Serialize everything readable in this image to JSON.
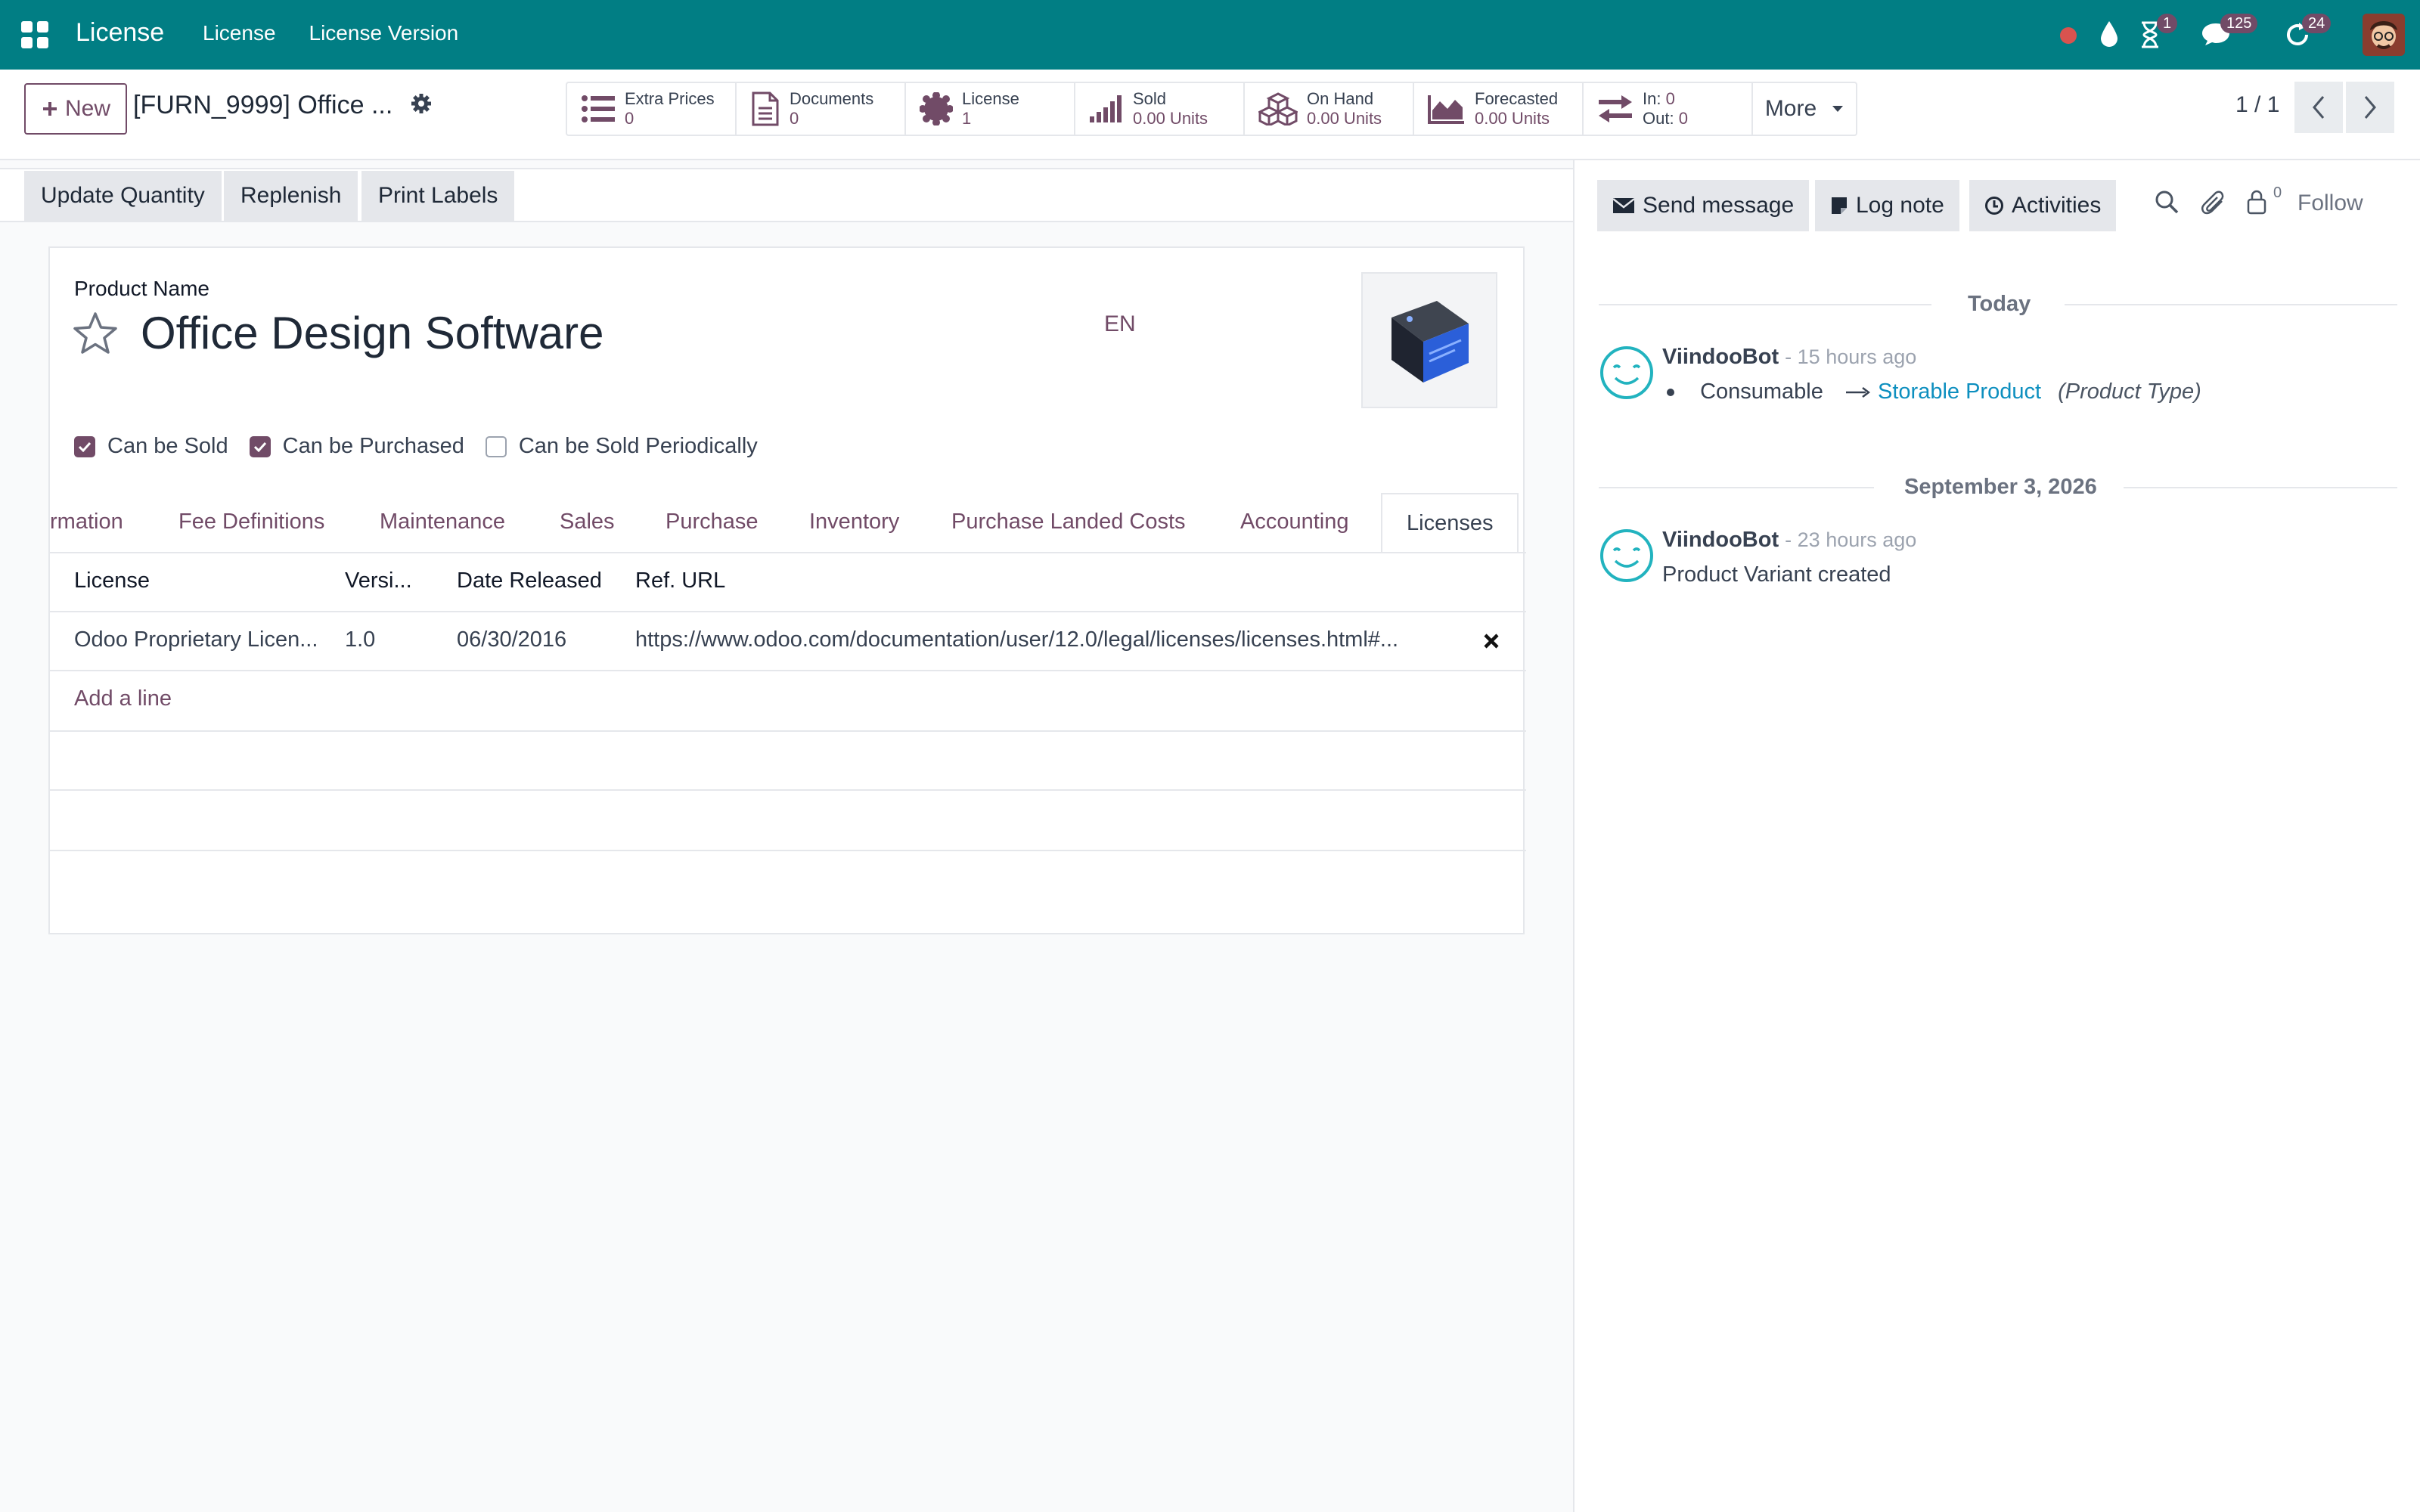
{
  "topbar": {
    "app_title": "License",
    "menu": [
      "License",
      "License Version"
    ],
    "badges": {
      "activity": "1",
      "messages": "125",
      "updates": "24"
    }
  },
  "control": {
    "new_label": "New",
    "breadcrumb": "[FURN_9999] Office ...",
    "smart_buttons": [
      {
        "label": "Extra Prices",
        "value": "0",
        "icon": "list-icon"
      },
      {
        "label": "Documents",
        "value": "0",
        "icon": "document-icon"
      },
      {
        "label": "License",
        "value": "1",
        "icon": "certificate-icon"
      },
      {
        "label": "Sold",
        "value": "0.00 Units",
        "icon": "signal-icon"
      },
      {
        "label": "On Hand",
        "value": "0.00 Units",
        "icon": "cubes-icon"
      },
      {
        "label": "Forecasted",
        "value": "0.00 Units",
        "icon": "area-chart-icon"
      },
      {
        "in": "In:",
        "in_val": "0",
        "out": "Out:",
        "out_val": "0",
        "icon": "exchange-icon"
      }
    ],
    "more_label": "More",
    "pager": "1 / 1"
  },
  "actions": [
    "Update Quantity",
    "Replenish",
    "Print Labels"
  ],
  "form": {
    "name_label": "Product Name",
    "product_name": "Office Design Software",
    "lang": "EN",
    "checkboxes": [
      {
        "label": "Can be Sold",
        "checked": true
      },
      {
        "label": "Can be Purchased",
        "checked": true
      },
      {
        "label": "Can be Sold Periodically",
        "checked": false
      }
    ],
    "tabs": [
      "rmation",
      "Fee Definitions",
      "Maintenance",
      "Sales",
      "Purchase",
      "Inventory",
      "Purchase Landed Costs",
      "Accounting",
      "Licenses"
    ],
    "table": {
      "headers": [
        "License",
        "Versi...",
        "Date Released",
        "Ref. URL"
      ],
      "rows": [
        [
          "Odoo Proprietary Licen...",
          "1.0",
          "06/30/2016",
          "https://www.odoo.com/documentation/user/12.0/legal/licenses/licenses.html#..."
        ]
      ],
      "add_line": "Add a line"
    }
  },
  "chatter": {
    "send_message": "Send message",
    "log_note": "Log note",
    "activities": "Activities",
    "follower_count": "0",
    "follow": "Follow",
    "groups": [
      {
        "date": "Today",
        "author": "ViindooBot",
        "time": "- 15 hours ago",
        "old_value": "Consumable",
        "new_value": "Storable Product",
        "field": "(Product Type)"
      },
      {
        "date": "September 3, 2026",
        "author": "ViindooBot",
        "time": "- 23 hours ago",
        "body": "Product Variant created"
      }
    ]
  },
  "colors": {
    "topbar": "#017e84",
    "brand": "#714b67",
    "link": "#0d8fbf"
  }
}
